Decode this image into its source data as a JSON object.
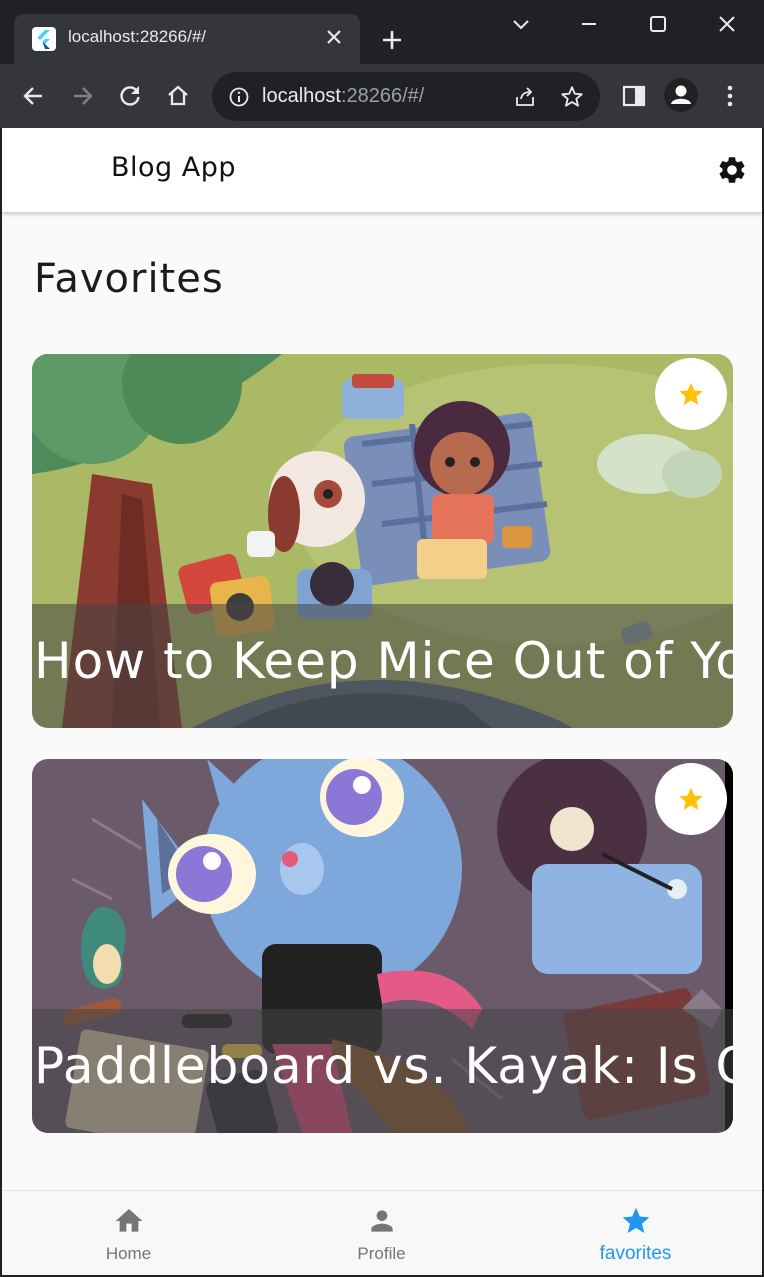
{
  "browser": {
    "tab_title": "localhost:28266/#/",
    "url_host": "localhost",
    "url_rest": ":28266/#/"
  },
  "app": {
    "title": "Blog App",
    "page_title": "Favorites"
  },
  "posts": [
    {
      "title": "How to Keep Mice Out of Your House",
      "favorited": true
    },
    {
      "title": "Paddleboard vs. Kayak: Is One Better?",
      "favorited": true
    }
  ],
  "bottom_nav": {
    "items": [
      {
        "label": "Home",
        "icon": "home-icon"
      },
      {
        "label": "Profile",
        "icon": "person-icon"
      },
      {
        "label": "favorites",
        "icon": "star-icon"
      }
    ],
    "active_index": 2
  },
  "colors": {
    "accent": "#2196f3",
    "star": "#ffc107"
  }
}
